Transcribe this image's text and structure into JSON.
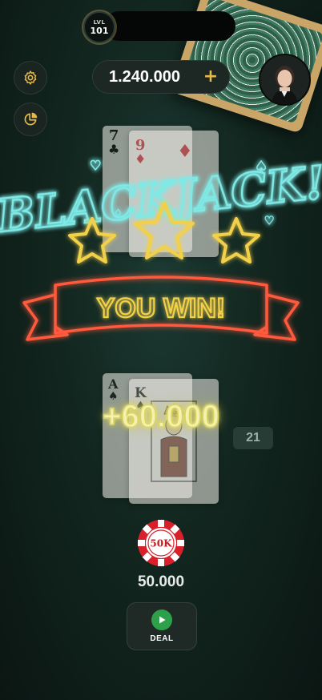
{
  "hud": {
    "level_prefix": "LVL",
    "level": "101",
    "balance": "1.240.000",
    "add_funds_symbol": "+"
  },
  "result": {
    "headline": "BLACKJACK!",
    "banner": "YOU WIN!",
    "stars_lit": 3,
    "win_amount": "+60.000"
  },
  "dealer_hand": {
    "cards": [
      {
        "rank": "7",
        "suit": "♣"
      },
      {
        "rank": "9",
        "suit": "♦"
      }
    ]
  },
  "player_hand": {
    "cards": [
      {
        "rank": "A",
        "suit": "♠"
      },
      {
        "rank": "K",
        "suit": "♠"
      }
    ],
    "score": "21"
  },
  "bet": {
    "chip_label": "50K",
    "amount": "50.000"
  },
  "actions": {
    "deal_label": "DEAL"
  },
  "colors": {
    "neon_cyan": "#7fe9e6",
    "neon_yellow": "#f2d04a",
    "neon_red": "#ff5a3c",
    "chip_red": "#d8202b",
    "deal_green": "#2fa04a"
  }
}
